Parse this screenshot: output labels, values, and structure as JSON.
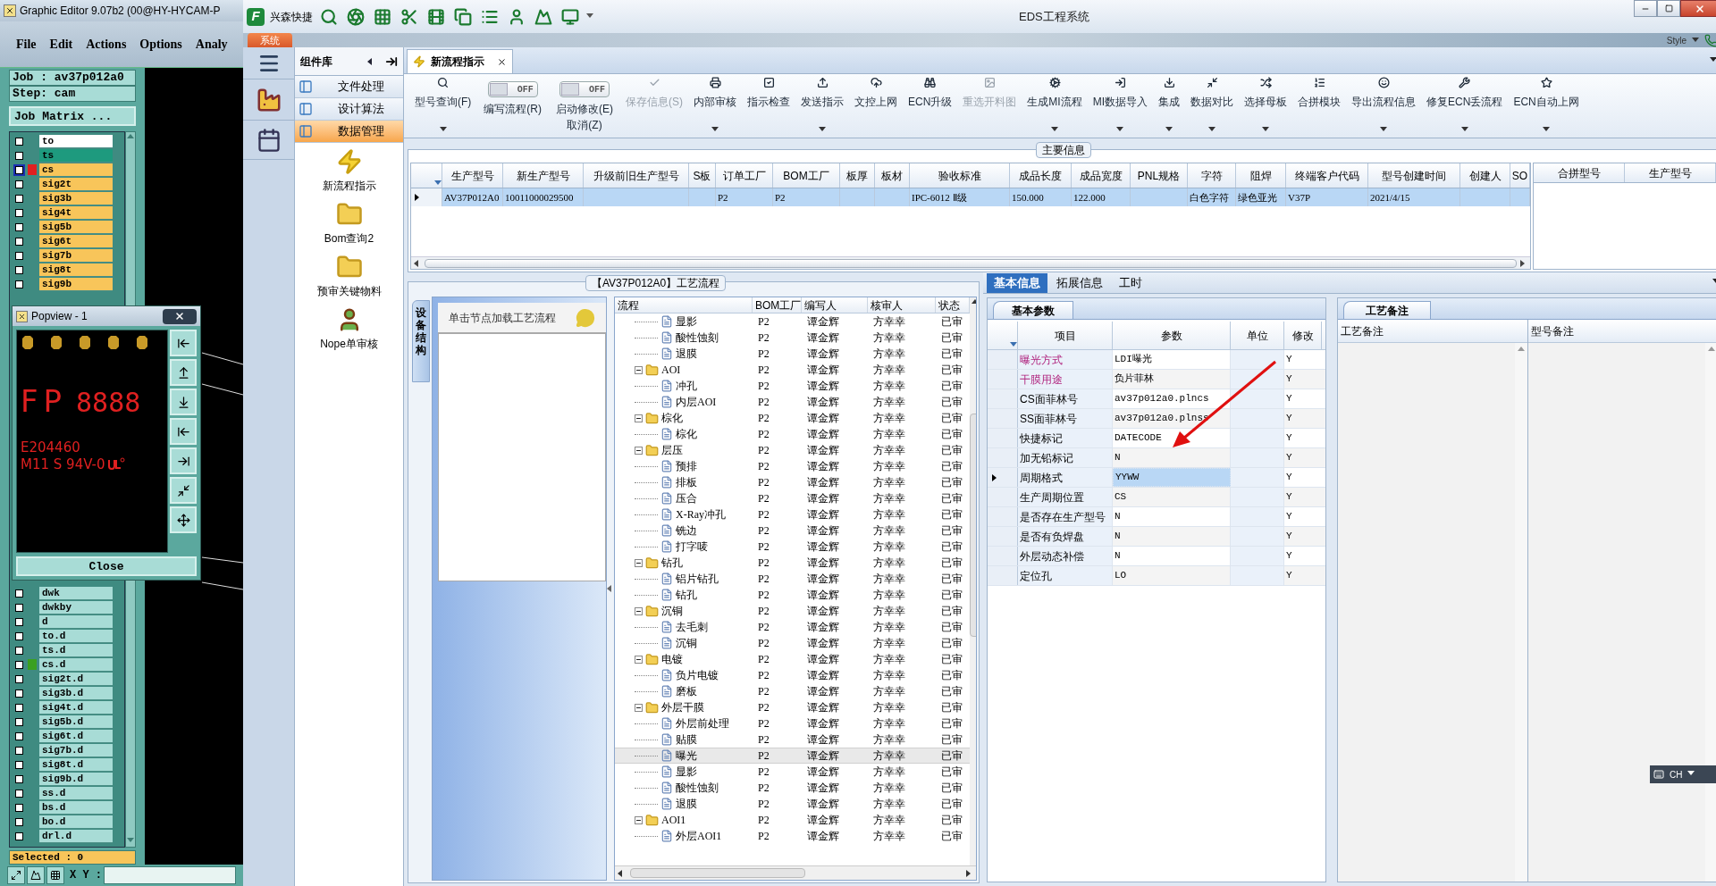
{
  "genesis": {
    "title": "Graphic Editor 9.07b2 (00@HY-HYCAM-P",
    "menu": [
      "File",
      "Edit",
      "Actions",
      "Options",
      "Analy"
    ],
    "job": "Job : av37p012a0",
    "step": "Step: cam",
    "matrix_button": "Job Matrix ...",
    "layers_top": [
      {
        "name": "to",
        "color": "#ffffff",
        "checked": false,
        "selected": false
      },
      {
        "name": "ts",
        "color": "#1e9a7e",
        "checked": false,
        "selected": false
      },
      {
        "name": "cs",
        "color": "#f8c55a",
        "checked": false,
        "selected": true,
        "marker": {
          "color": "#e02020"
        }
      },
      {
        "name": "sig2t",
        "color": "#f8c55a",
        "checked": false,
        "selected": false
      },
      {
        "name": "sig3b",
        "color": "#f8c55a",
        "checked": false,
        "selected": false
      },
      {
        "name": "sig4t",
        "color": "#f8c55a",
        "checked": false,
        "selected": false
      },
      {
        "name": "sig5b",
        "color": "#f8c55a",
        "checked": false,
        "selected": false
      },
      {
        "name": "sig6t",
        "color": "#f8c55a",
        "checked": false,
        "selected": false
      },
      {
        "name": "sig7b",
        "color": "#f8c55a",
        "checked": false,
        "selected": false
      },
      {
        "name": "sig8t",
        "color": "#f8c55a",
        "checked": false,
        "selected": false
      },
      {
        "name": "sig9b",
        "color": "#f8c55a",
        "checked": false,
        "selected": false
      }
    ],
    "layers_bottom": [
      {
        "name": "dwk",
        "color": "#a8dcd6",
        "checked": false,
        "selected": false
      },
      {
        "name": "dwkby",
        "color": "#a8dcd6",
        "checked": false,
        "selected": false
      },
      {
        "name": "d",
        "color": "#a8dcd6",
        "checked": false,
        "selected": false
      },
      {
        "name": "to.d",
        "color": "#a8dcd6",
        "checked": false,
        "selected": false
      },
      {
        "name": "ts.d",
        "color": "#a8dcd6",
        "checked": false,
        "selected": false
      },
      {
        "name": "cs.d",
        "color": "#a8dcd6",
        "checked": false,
        "selected": false,
        "marker": {
          "color": "#3aa020"
        }
      },
      {
        "name": "sig2t.d",
        "color": "#a8dcd6",
        "checked": false,
        "selected": false
      },
      {
        "name": "sig3b.d",
        "color": "#a8dcd6",
        "checked": false,
        "selected": false
      },
      {
        "name": "sig4t.d",
        "color": "#a8dcd6",
        "checked": false,
        "selected": false
      },
      {
        "name": "sig5b.d",
        "color": "#a8dcd6",
        "checked": false,
        "selected": false
      },
      {
        "name": "sig6t.d",
        "color": "#a8dcd6",
        "checked": false,
        "selected": false
      },
      {
        "name": "sig7b.d",
        "color": "#a8dcd6",
        "checked": false,
        "selected": false
      },
      {
        "name": "sig8t.d",
        "color": "#a8dcd6",
        "checked": false,
        "selected": false
      },
      {
        "name": "sig9b.d",
        "color": "#a8dcd6",
        "checked": false,
        "selected": false
      },
      {
        "name": "ss.d",
        "color": "#a8dcd6",
        "checked": false,
        "selected": false
      },
      {
        "name": "bs.d",
        "color": "#a8dcd6",
        "checked": false,
        "selected": false
      },
      {
        "name": "bo.d",
        "color": "#a8dcd6",
        "checked": false,
        "selected": false
      },
      {
        "name": "drl.d",
        "color": "#a8dcd6",
        "checked": false,
        "selected": false
      }
    ],
    "selected_count": "Selected : 0",
    "xy_label": "X Y :"
  },
  "popview": {
    "title": "Popview - 1",
    "artwork_texts": [
      "FP",
      "8888",
      "E204460",
      "M11 S 94V-0"
    ],
    "close": "Close"
  },
  "eds": {
    "logo_letter": "F",
    "quick_label": "兴森快捷",
    "title": "EDS工程系统",
    "system_tab": "系统",
    "style_label": "Style",
    "library": {
      "title": "组件库",
      "sections": [
        {
          "label": "文件处理",
          "selected": false
        },
        {
          "label": "设计算法",
          "selected": false
        },
        {
          "label": "数据管理",
          "selected": true
        }
      ],
      "items": [
        {
          "label": "新流程指示",
          "kind": "bolt"
        },
        {
          "label": "Bom查询2",
          "kind": "folder"
        },
        {
          "label": "预审关键物料",
          "kind": "folder"
        },
        {
          "label": "Nope单审核",
          "kind": "person"
        }
      ]
    },
    "doc_tab": "新流程指示",
    "toolbar": [
      {
        "kind": "button",
        "label": "型号查询(F)",
        "disabled": false,
        "dropdown": true
      },
      {
        "kind": "toggle",
        "label": "编写流程(R)",
        "switch_text": "OFF",
        "on": false,
        "disabled": false,
        "dropdown": false
      },
      {
        "kind": "toggle",
        "label": "启动修改(E)",
        "switch_text": "OFF",
        "on": false,
        "sublabel": "取消(Z)",
        "disabled": false,
        "dropdown": false
      },
      {
        "kind": "button",
        "label": "保存信息(S)",
        "disabled": true,
        "dropdown": false
      },
      {
        "kind": "button",
        "label": "内部审核",
        "disabled": false,
        "dropdown": true
      },
      {
        "kind": "button",
        "label": "指示检查",
        "disabled": false,
        "dropdown": false
      },
      {
        "kind": "button",
        "label": "发送指示",
        "disabled": false,
        "dropdown": true
      },
      {
        "kind": "button",
        "label": "文控上网",
        "disabled": false,
        "dropdown": false
      },
      {
        "kind": "button",
        "label": "ECN升级",
        "disabled": false,
        "dropdown": false
      },
      {
        "kind": "button",
        "label": "重选开料图",
        "disabled": true,
        "dropdown": false
      },
      {
        "kind": "button",
        "label": "生成MI流程",
        "disabled": false,
        "dropdown": true
      },
      {
        "kind": "button",
        "label": "MI数据导入",
        "disabled": false,
        "dropdown": true
      },
      {
        "kind": "button",
        "label": "集成",
        "disabled": false,
        "dropdown": true
      },
      {
        "kind": "button",
        "label": "数据对比",
        "disabled": false,
        "dropdown": true
      },
      {
        "kind": "button",
        "label": "选择母板",
        "disabled": false,
        "dropdown": true
      },
      {
        "kind": "button",
        "label": "合拼模块",
        "disabled": false,
        "dropdown": false
      },
      {
        "kind": "button",
        "label": "导出流程信息",
        "disabled": false,
        "dropdown": true
      },
      {
        "kind": "button",
        "label": "修复ECN丢流程",
        "disabled": false,
        "dropdown": true
      },
      {
        "kind": "button",
        "label": "ECN自动上网",
        "disabled": false,
        "dropdown": true
      }
    ],
    "main_info": {
      "title": "主要信息",
      "row_selected": true,
      "columns": [
        {
          "label": "生产型号",
          "value": "AV37P012A0"
        },
        {
          "label": "新生产型号",
          "value": "10011000029500"
        },
        {
          "label": "升级前旧生产型号"
        },
        {
          "label": "S板"
        },
        {
          "label": "订单工厂",
          "value": "P2"
        },
        {
          "label": "BOM工厂",
          "value": "P2"
        },
        {
          "label": "板厚"
        },
        {
          "label": "板材"
        },
        {
          "label": "验收标准",
          "value": "IPC-6012 Ⅱ级"
        },
        {
          "label": "成品长度",
          "value": "150.000"
        },
        {
          "label": "成品宽度",
          "value": "122.000"
        },
        {
          "label": "PNL规格"
        },
        {
          "label": "字符",
          "value": "白色字符"
        },
        {
          "label": "阻焊",
          "value": "绿色亚光"
        },
        {
          "label": "终端客户代码",
          "value": "V37P"
        },
        {
          "label": "型号创建时间",
          "value": "2021/4/15"
        },
        {
          "label": "创建人"
        },
        {
          "label": "SO"
        }
      ],
      "side_columns": [
        "合拼型号",
        "生产型号"
      ]
    },
    "process": {
      "title": "【AV37P012A0】工艺流程",
      "side_tab": "设备结构",
      "hint": "单击节点加载工艺流程",
      "columns": [
        "流程",
        "BOM工厂",
        "编写人",
        "核审人",
        "状态"
      ],
      "rows": [
        {
          "kind": "step",
          "name": "显影",
          "bom": "P2",
          "writer": "谭金辉",
          "reviewer": "方幸幸",
          "status": "已审",
          "selected": false
        },
        {
          "kind": "step",
          "name": "酸性蚀刻",
          "bom": "P2",
          "writer": "谭金辉",
          "reviewer": "方幸幸",
          "status": "已审",
          "selected": false
        },
        {
          "kind": "step",
          "name": "退膜",
          "bom": "P2",
          "writer": "谭金辉",
          "reviewer": "方幸幸",
          "status": "已审",
          "selected": false
        },
        {
          "kind": "group",
          "name": "AOI",
          "bom": "P2",
          "writer": "谭金辉",
          "reviewer": "方幸幸",
          "status": "已审",
          "selected": false,
          "expanded": true,
          "children": [
            {
              "kind": "step",
              "name": "冲孔",
              "bom": "P2",
              "writer": "谭金辉",
              "reviewer": "方幸幸",
              "status": "已审",
              "selected": false
            },
            {
              "kind": "step",
              "name": "内层AOI",
              "bom": "P2",
              "writer": "谭金辉",
              "reviewer": "方幸幸",
              "status": "已审",
              "selected": false
            }
          ]
        },
        {
          "kind": "group",
          "name": "棕化",
          "bom": "P2",
          "writer": "谭金辉",
          "reviewer": "方幸幸",
          "status": "已审",
          "selected": false,
          "expanded": true,
          "children": [
            {
              "kind": "step",
              "name": "棕化",
              "bom": "P2",
              "writer": "谭金辉",
              "reviewer": "方幸幸",
              "status": "已审",
              "selected": false
            }
          ]
        },
        {
          "kind": "group",
          "name": "层压",
          "bom": "P2",
          "writer": "谭金辉",
          "reviewer": "方幸幸",
          "status": "已审",
          "selected": false,
          "expanded": true,
          "children": [
            {
              "kind": "step",
              "name": "预排",
              "bom": "P2",
              "writer": "谭金辉",
              "reviewer": "方幸幸",
              "status": "已审",
              "selected": false
            },
            {
              "kind": "step",
              "name": "排板",
              "bom": "P2",
              "writer": "谭金辉",
              "reviewer": "方幸幸",
              "status": "已审",
              "selected": false
            },
            {
              "kind": "step",
              "name": "压合",
              "bom": "P2",
              "writer": "谭金辉",
              "reviewer": "方幸幸",
              "status": "已审",
              "selected": false
            },
            {
              "kind": "step",
              "name": "X-Ray冲孔",
              "bom": "P2",
              "writer": "谭金辉",
              "reviewer": "方幸幸",
              "status": "已审",
              "selected": false
            },
            {
              "kind": "step",
              "name": "铣边",
              "bom": "P2",
              "writer": "谭金辉",
              "reviewer": "方幸幸",
              "status": "已审",
              "selected": false
            },
            {
              "kind": "step",
              "name": "打字唛",
              "bom": "P2",
              "writer": "谭金辉",
              "reviewer": "方幸幸",
              "status": "已审",
              "selected": false
            }
          ]
        },
        {
          "kind": "group",
          "name": "钻孔",
          "bom": "P2",
          "writer": "谭金辉",
          "reviewer": "方幸幸",
          "status": "已审",
          "selected": false,
          "expanded": true,
          "children": [
            {
              "kind": "step",
              "name": "铝片钻孔",
              "bom": "P2",
              "writer": "谭金辉",
              "reviewer": "方幸幸",
              "status": "已审",
              "selected": false
            },
            {
              "kind": "step",
              "name": "钻孔",
              "bom": "P2",
              "writer": "谭金辉",
              "reviewer": "方幸幸",
              "status": "已审",
              "selected": false
            }
          ]
        },
        {
          "kind": "group",
          "name": "沉铜",
          "bom": "P2",
          "writer": "谭金辉",
          "reviewer": "方幸幸",
          "status": "已审",
          "selected": false,
          "expanded": true,
          "children": [
            {
              "kind": "step",
              "name": "去毛刺",
              "bom": "P2",
              "writer": "谭金辉",
              "reviewer": "方幸幸",
              "status": "已审",
              "selected": false
            },
            {
              "kind": "step",
              "name": "沉铜",
              "bom": "P2",
              "writer": "谭金辉",
              "reviewer": "方幸幸",
              "status": "已审",
              "selected": false
            }
          ]
        },
        {
          "kind": "group",
          "name": "电镀",
          "bom": "P2",
          "writer": "谭金辉",
          "reviewer": "方幸幸",
          "status": "已审",
          "selected": false,
          "expanded": true,
          "children": [
            {
              "kind": "step",
              "name": "负片电镀",
              "bom": "P2",
              "writer": "谭金辉",
              "reviewer": "方幸幸",
              "status": "已审",
              "selected": false
            },
            {
              "kind": "step",
              "name": "磨板",
              "bom": "P2",
              "writer": "谭金辉",
              "reviewer": "方幸幸",
              "status": "已审",
              "selected": false
            }
          ]
        },
        {
          "kind": "group",
          "name": "外层干膜",
          "bom": "P2",
          "writer": "谭金辉",
          "reviewer": "方幸幸",
          "status": "已审",
          "selected": false,
          "expanded": true,
          "children": [
            {
              "kind": "step",
              "name": "外层前处理",
              "bom": "P2",
              "writer": "谭金辉",
              "reviewer": "方幸幸",
              "status": "已审",
              "selected": false
            },
            {
              "kind": "step",
              "name": "贴膜",
              "bom": "P2",
              "writer": "谭金辉",
              "reviewer": "方幸幸",
              "status": "已审",
              "selected": false
            },
            {
              "kind": "step",
              "name": "曝光",
              "bom": "P2",
              "writer": "谭金辉",
              "reviewer": "方幸幸",
              "status": "已审",
              "selected": true
            },
            {
              "kind": "step",
              "name": "显影",
              "bom": "P2",
              "writer": "谭金辉",
              "reviewer": "方幸幸",
              "status": "已审",
              "selected": false
            },
            {
              "kind": "step",
              "name": "酸性蚀刻",
              "bom": "P2",
              "writer": "谭金辉",
              "reviewer": "方幸幸",
              "status": "已审",
              "selected": false
            },
            {
              "kind": "step",
              "name": "退膜",
              "bom": "P2",
              "writer": "谭金辉",
              "reviewer": "方幸幸",
              "status": "已审",
              "selected": false
            }
          ]
        },
        {
          "kind": "group",
          "name": "AOI1",
          "bom": "P2",
          "writer": "谭金辉",
          "reviewer": "方幸幸",
          "status": "已审",
          "selected": false,
          "expanded": true,
          "children": [
            {
              "kind": "step",
              "name": "外层AOI1",
              "bom": "P2",
              "writer": "谭金辉",
              "reviewer": "方幸幸",
              "status": "已审",
              "selected": false
            }
          ]
        }
      ]
    },
    "detail": {
      "tabs": [
        {
          "label": "基本信息",
          "selected": true
        },
        {
          "label": "拓展信息",
          "selected": false
        },
        {
          "label": "工时",
          "selected": false
        }
      ],
      "params": {
        "tab": "基本参数",
        "columns": [
          "项目",
          "参数",
          "单位",
          "修改"
        ],
        "rows": [
          {
            "item": "曝光方式",
            "value": "LDI曝光",
            "modified": "Y",
            "highlighted": true,
            "selected": false
          },
          {
            "item": "干膜用途",
            "value": "负片菲林",
            "modified": "Y",
            "highlighted": true,
            "selected": false
          },
          {
            "item": "CS面菲林号",
            "value": "av37p012a0.plncs",
            "modified": "Y",
            "highlighted": false,
            "selected": false
          },
          {
            "item": "SS面菲林号",
            "value": "av37p012a0.plnss",
            "modified": "Y",
            "highlighted": false,
            "selected": false
          },
          {
            "item": "快捷标记",
            "value": "DATECODE",
            "modified": "Y",
            "highlighted": false,
            "selected": false
          },
          {
            "item": "加无铅标记",
            "value": "N",
            "modified": "Y",
            "highlighted": false,
            "selected": false
          },
          {
            "item": "周期格式",
            "value": "YYWW",
            "modified": "Y",
            "highlighted": false,
            "selected": true
          },
          {
            "item": "生产周期位置",
            "value": "CS",
            "modified": "Y",
            "highlighted": false,
            "selected": false
          },
          {
            "item": "是否存在生产型号",
            "value": "N",
            "modified": "Y",
            "highlighted": false,
            "selected": false
          },
          {
            "item": "是否有负焊盘",
            "value": "N",
            "modified": "Y",
            "highlighted": false,
            "selected": false
          },
          {
            "item": "外层动态补偿",
            "value": "N",
            "modified": "Y",
            "highlighted": false,
            "selected": false
          },
          {
            "item": "定位孔",
            "value": "LO",
            "modified": "Y",
            "highlighted": false,
            "selected": false
          }
        ]
      },
      "notes": {
        "tab": "工艺备注",
        "columns": [
          "工艺备注",
          "型号备注"
        ]
      }
    },
    "language_bar": "CH"
  }
}
